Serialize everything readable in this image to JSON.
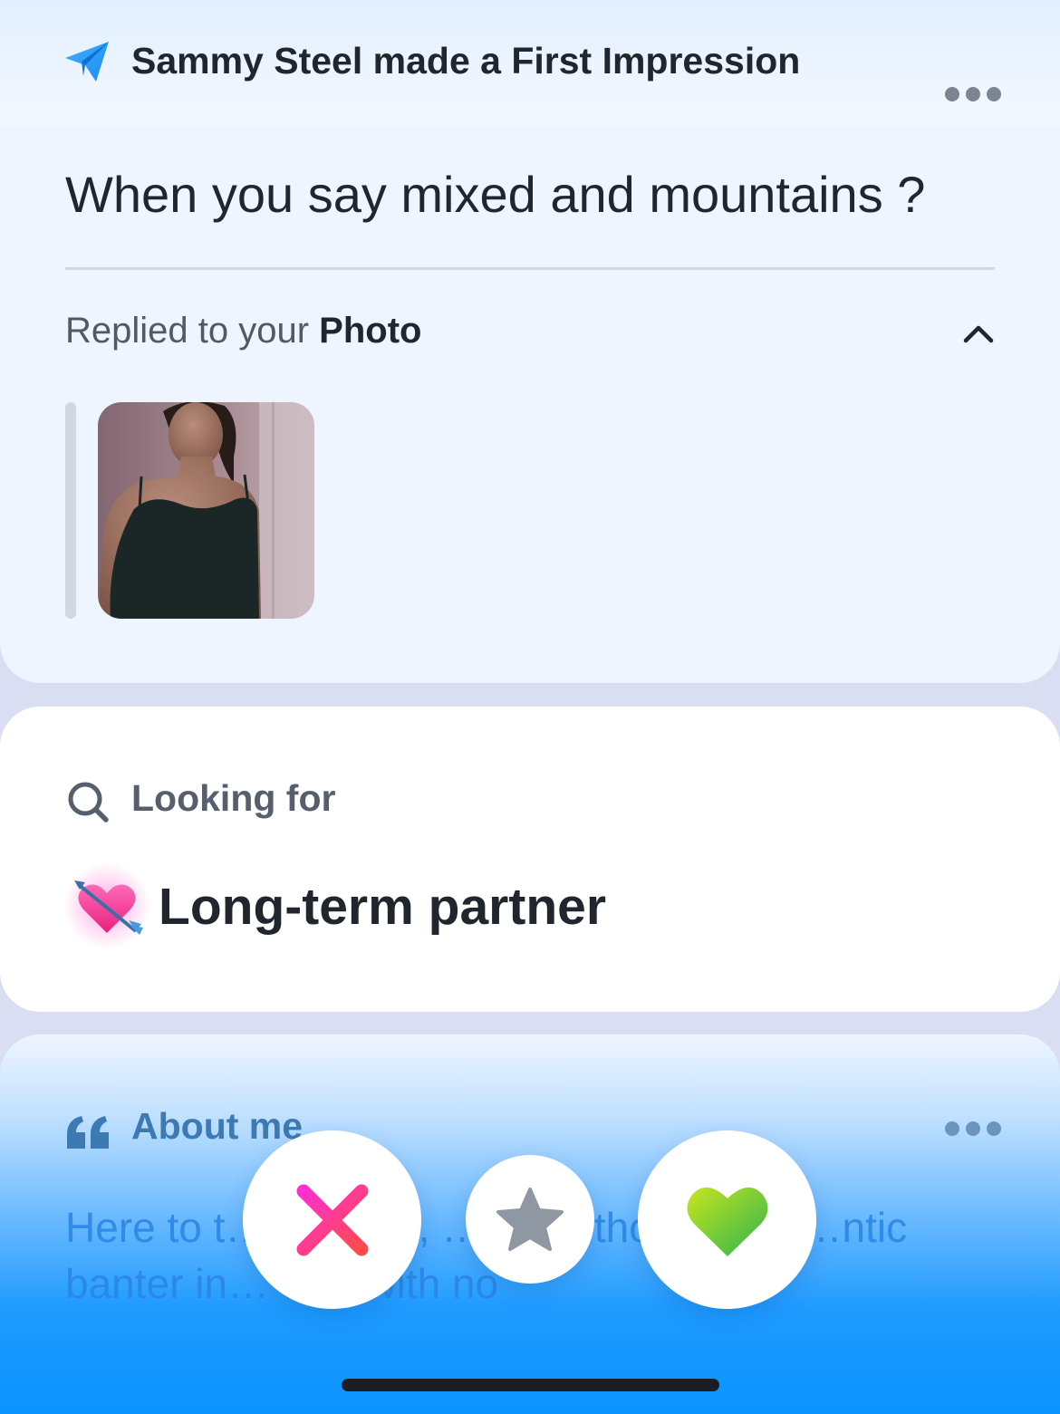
{
  "impression": {
    "title": "Sammy Steel made a First Impression",
    "message": "When you say mixed and mountains ?",
    "replied_prefix": "Replied to your ",
    "replied_target": "Photo"
  },
  "looking_for": {
    "label": "Looking for",
    "value": "Long-term partner"
  },
  "about": {
    "label": "About me",
    "text": "Here to t… of… 😊, …cient, thoughtful, …ntic banter in… …al with no"
  },
  "actions": {
    "nope": "nope",
    "super_like": "super-like",
    "like": "like"
  },
  "icons": {
    "header": "paper-plane-icon",
    "menu": "more-dots-icon",
    "collapse": "chevron-up-icon",
    "looking_for": "search-icon",
    "looking_emoji": "heart-with-arrow-icon",
    "about": "quote-icon",
    "nope": "x-icon",
    "super_like": "star-icon",
    "like": "heart-icon"
  },
  "colors": {
    "accent_blue": "#1f9bff",
    "nope_gradient": [
      "#ff2fd0",
      "#ff4a4a"
    ],
    "like_gradient": [
      "#c9e51e",
      "#2bb34f"
    ],
    "star_gray": "#8e97a2"
  }
}
